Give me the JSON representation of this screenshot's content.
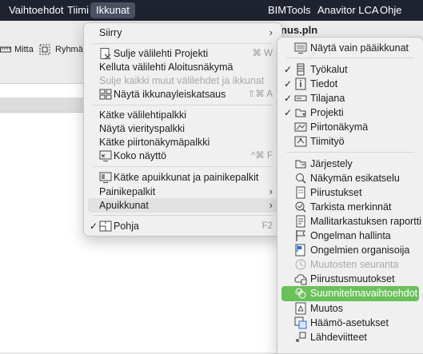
{
  "menubar": {
    "items": [
      "Vaihtoehdot",
      "Tiimi",
      "Ikkunat",
      "BIMTools",
      "Anavitor LCA",
      "Ohje"
    ]
  },
  "toolbar": {
    "mitta": "Mitta",
    "ryhmat": "Ryhmät",
    "window_title": "nus.pln"
  },
  "ikkunat_menu": {
    "siirry": "Siirry",
    "sulje_valilehti": "Sulje välilehti Projekti",
    "sulje_valilehti_shortcut": "⌘ W",
    "kelluta": "Kelluta välilehti Aloitusnäkymä",
    "sulje_kaikki": "Sulje kaikki muut välilehdet ja ikkunat",
    "nayta_yleiskatsaus": "Näytä ikkunayleiskatsaus",
    "nayta_yleiskatsaus_shortcut": "⇧⌘ A",
    "katke_valilehtipalkki": "Kätke välilehtipalkki",
    "nayta_vierityspalkki": "Näytä vierityspalkki",
    "katke_piirtonakyma": "Kätke piirtonäkymäpalkki",
    "koko_naytto": "Koko näyttö",
    "koko_naytto_shortcut": "^⌘ F",
    "katke_apuikkunat": "Kätke apuikkunat ja painikepalkit",
    "painikepalkit": "Painikepalkit",
    "apuikkunat": "Apuikkunat",
    "pohja": "Pohja",
    "pohja_shortcut": "F2"
  },
  "apuikkunat_menu": {
    "items": [
      {
        "label": "Näytä vain pääikkunat",
        "checked": false,
        "icon": "main-windows-icon"
      },
      {
        "label": "Työkalut",
        "checked": true,
        "icon": "toolbox-icon"
      },
      {
        "label": "Tiedot",
        "checked": true,
        "icon": "info-icon"
      },
      {
        "label": "Tilajana",
        "checked": true,
        "icon": "statusbar-icon"
      },
      {
        "label": "Projekti",
        "checked": true,
        "icon": "navigator-icon"
      },
      {
        "label": "Piirtonäkymä",
        "checked": false,
        "icon": "drawing-view-icon"
      },
      {
        "label": "Tiimityö",
        "checked": false,
        "icon": "teamwork-icon"
      },
      {
        "label": "Järjestely",
        "checked": false,
        "icon": "organizer-icon"
      },
      {
        "label": "Näkymän esikatselu",
        "checked": false,
        "icon": "view-preview-icon"
      },
      {
        "label": "Piirustukset",
        "checked": false,
        "icon": "drawings-icon"
      },
      {
        "label": "Tarkista merkinnät",
        "checked": false,
        "icon": "check-markup-icon"
      },
      {
        "label": "Mallitarkastuksen raportti",
        "checked": false,
        "icon": "model-check-report-icon"
      },
      {
        "label": "Ongelman hallinta",
        "checked": false,
        "icon": "issue-flag-icon"
      },
      {
        "label": "Ongelmien organisoija",
        "checked": false,
        "icon": "issue-organizer-icon"
      },
      {
        "label": "Muutosten seuranta",
        "checked": false,
        "icon": "change-tracking-icon",
        "disabled": true
      },
      {
        "label": "Piirustusmuutokset",
        "checked": false,
        "icon": "drawing-changes-icon"
      },
      {
        "label": "Suunnitelmavaihtoehdot",
        "checked": false,
        "icon": "design-options-icon",
        "selected": true
      },
      {
        "label": "Muutos",
        "checked": false,
        "icon": "change-icon"
      },
      {
        "label": "Häämö-asetukset",
        "checked": false,
        "icon": "ghost-settings-icon"
      },
      {
        "label": "Lähdeviitteet",
        "checked": false,
        "icon": "references-icon"
      }
    ]
  },
  "colors": {
    "menubar_bg": "#1f2330",
    "selected_bg": "#6ac15a",
    "menu_bg": "#f0f0f0"
  }
}
